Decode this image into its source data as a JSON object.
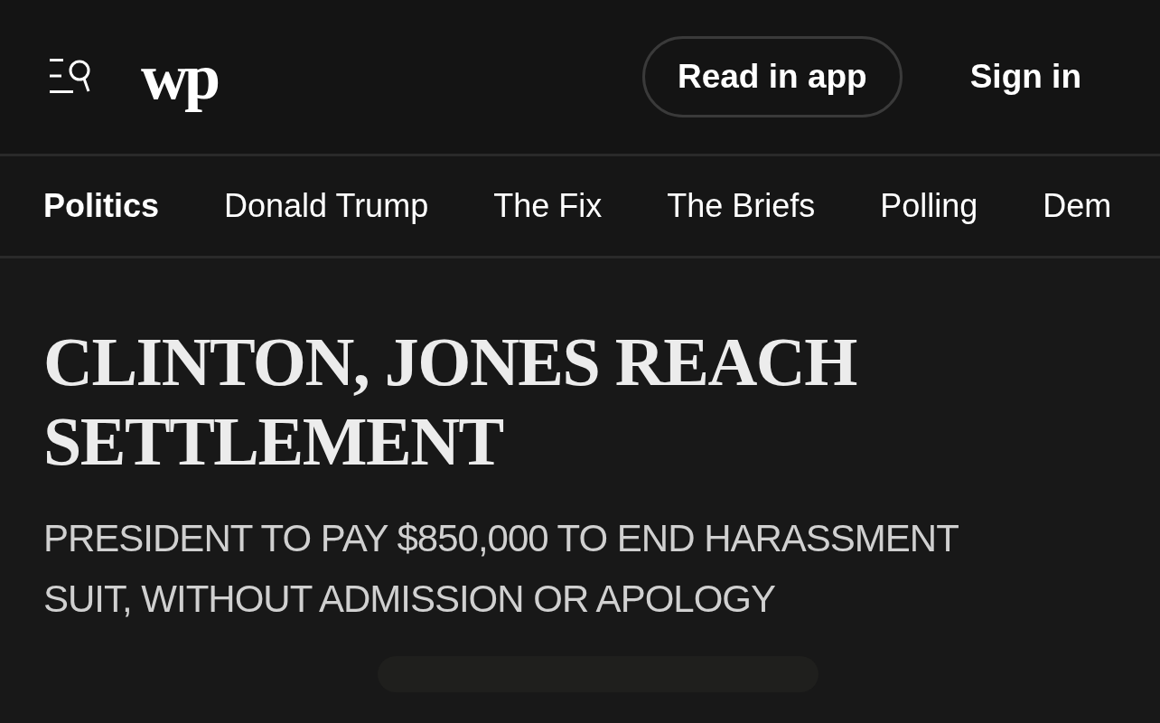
{
  "header": {
    "logo": "wp",
    "buttons": [
      {
        "label": "Read in app",
        "kind": "outlined"
      },
      {
        "label": "Sign in",
        "kind": "plain"
      }
    ]
  },
  "nav": [
    {
      "label": "Politics",
      "selected": true
    },
    {
      "label": "Donald Trump",
      "selected": false
    },
    {
      "label": "The Fix",
      "selected": false
    },
    {
      "label": "The Briefs",
      "selected": false
    },
    {
      "label": "Polling",
      "selected": false
    },
    {
      "label": "Dem",
      "selected": false
    }
  ],
  "article": {
    "headline": "CLINTON, JONES REACH SETTLEMENT",
    "subheadline": "PRESIDENT TO PAY $850,000 TO END HARASSMENT SUIT, WITHOUT ADMISSION OR APOLOGY"
  }
}
